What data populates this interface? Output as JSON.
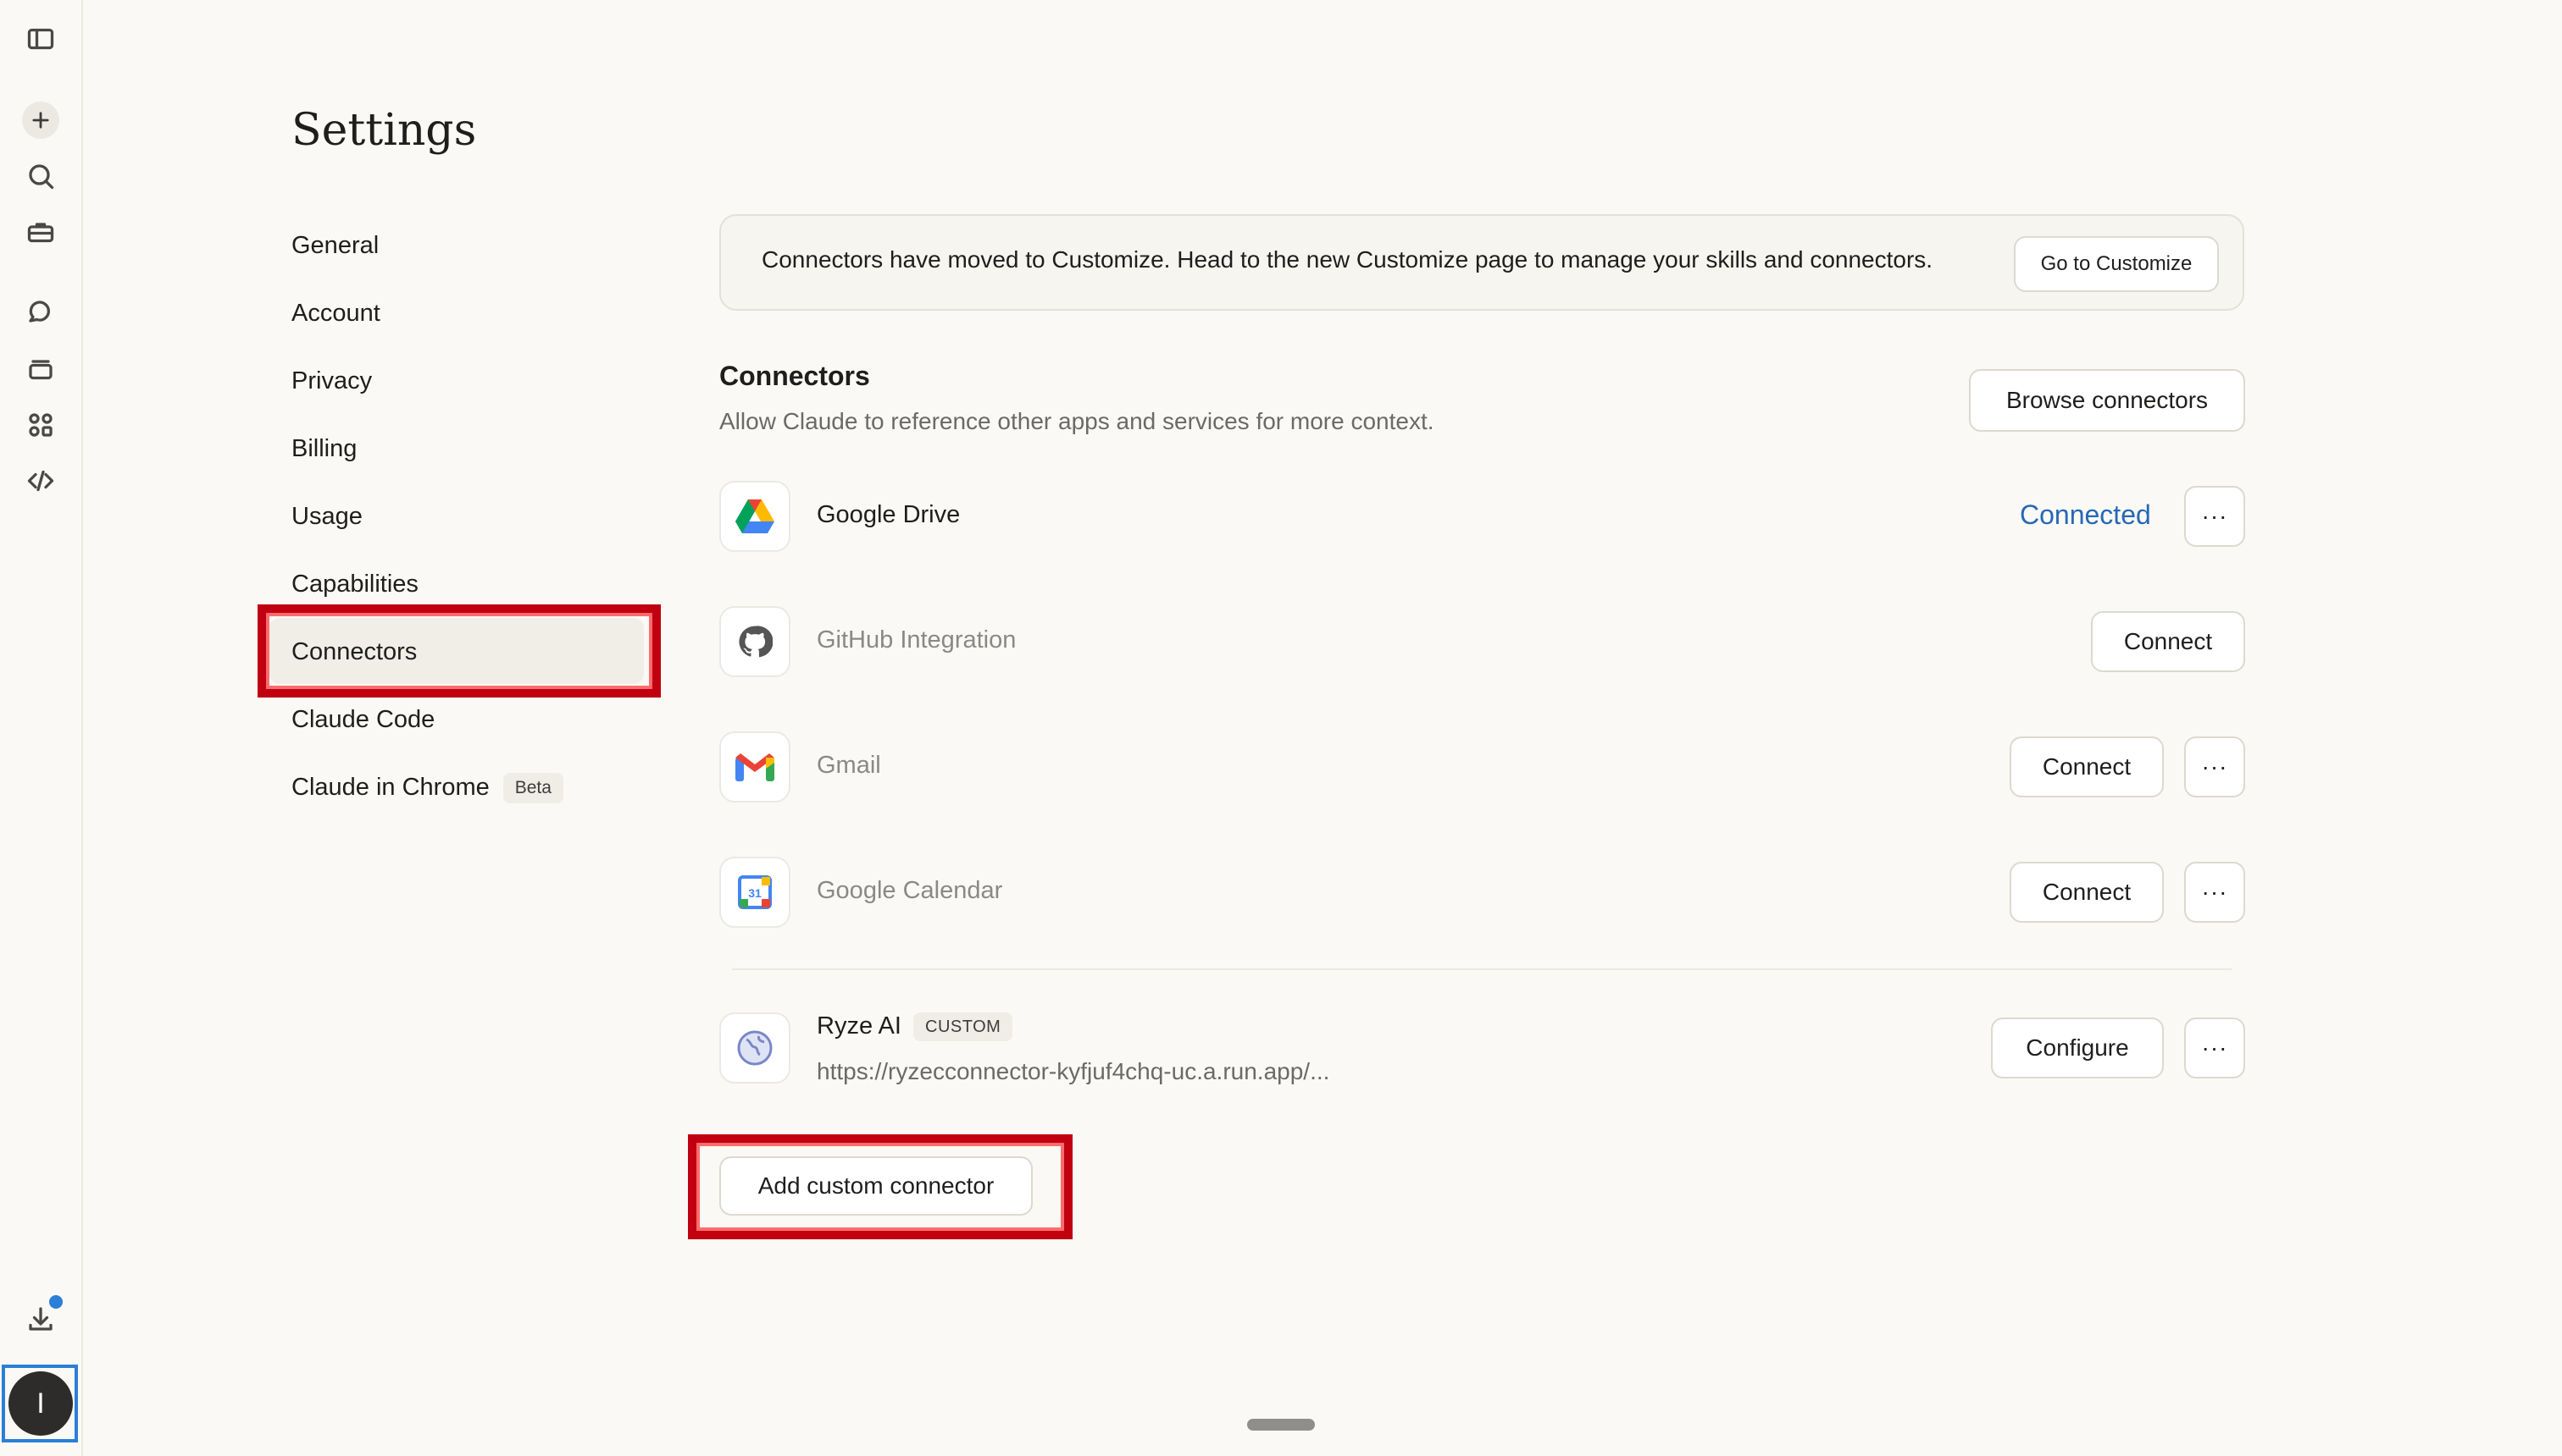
{
  "page": {
    "title": "Settings"
  },
  "nav": {
    "items": [
      "General",
      "Account",
      "Privacy",
      "Billing",
      "Usage",
      "Capabilities",
      "Connectors",
      "Claude Code",
      "Claude in Chrome"
    ],
    "active": "Connectors",
    "beta_badge": "Beta"
  },
  "banner": {
    "text": "Connectors have moved to Customize. Head to the new Customize page to manage your skills and connectors.",
    "button": "Go to Customize"
  },
  "connectors": {
    "title": "Connectors",
    "subtitle": "Allow Claude to reference other apps and services for more context.",
    "browse_button": "Browse connectors",
    "items": [
      {
        "name": "Google Drive",
        "status": "Connected",
        "more": "···"
      },
      {
        "name": "GitHub Integration",
        "action": "Connect"
      },
      {
        "name": "Gmail",
        "action": "Connect",
        "more": "···"
      },
      {
        "name": "Google Calendar",
        "action": "Connect",
        "more": "···",
        "icon_text": "31"
      },
      {
        "name": "Ryze AI",
        "badge": "CUSTOM",
        "url": "https://ryzecconnector-kyfjuf4chq-uc.a.run.app/...",
        "action": "Configure",
        "more": "···"
      }
    ],
    "add_custom": "Add custom connector"
  },
  "user": {
    "avatar_initial": "I"
  },
  "colors": {
    "accent_link": "#2768b6",
    "highlight": "#c00010",
    "notification": "#2b7fd6"
  }
}
